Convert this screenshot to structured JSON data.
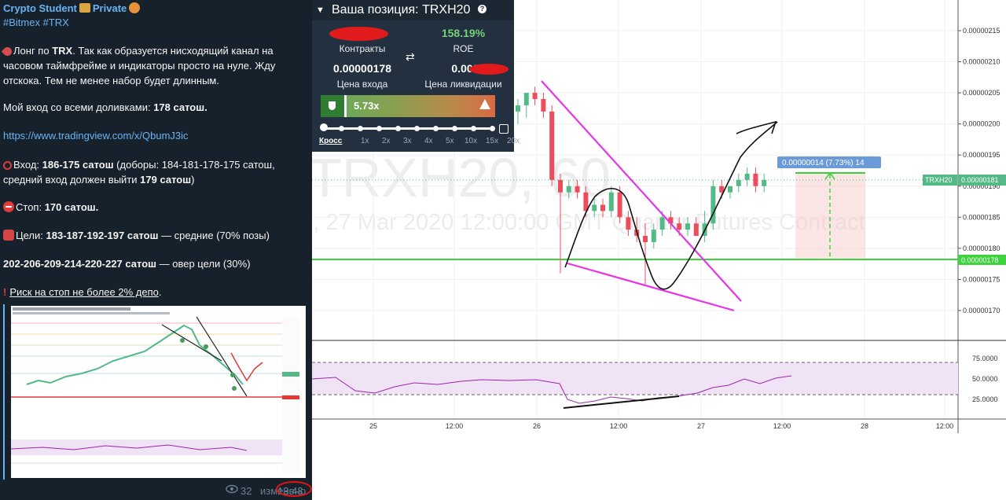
{
  "post": {
    "author": "Crypto Student",
    "author_suffix": "Private",
    "tags": "#Bitmex #TRX",
    "p1_a": "Лонг по ",
    "p1_b": "TRX",
    "p1_c": ". Так как образуется нисходящий канал на часовом таймфрейме и индикаторы просто на нуле. Жду отскока. Тем не менее набор будет длинным.",
    "p2_a": "Мой вход со всеми доливками: ",
    "p2_b": "178 сатош.",
    "link": "https://www.tradingview.com/x/QbumJ3ic",
    "entry_a": "Вход: ",
    "entry_b": "186-175 сатош",
    "entry_c": " (доборы: 184-181-178-175 сатош, средний вход должен выйти ",
    "entry_d": "179 сатош",
    "entry_e": ")",
    "stop_a": "Стоп: ",
    "stop_b": "170 сатош.",
    "targets_a": "Цели: ",
    "targets_b": "183-187-192-197 сатош",
    "targets_c": " — средние (70% позы)",
    "over_a": "202-206-209-214-220-227 сатош",
    "over_b": " — овер цели (30%)",
    "risk": "Риск на стоп не более 2% депо",
    "risk_dot": ".",
    "views": "32",
    "edited": "изменено",
    "time": "13:43"
  },
  "position": {
    "title": "Ваша позиция: TRXH20",
    "contracts_label": "Контракты",
    "roe_value": "158.19%",
    "roe_label": "ROE",
    "entry_value": "0.00000178",
    "entry_label": "Цена входа",
    "liq_value": "0.00000",
    "liq_label": "Цена ликвидации",
    "leverage": "5.73x",
    "leverage_steps": [
      "Кросс",
      "1x",
      "2x",
      "3x",
      "4x",
      "5x",
      "10x",
      "15x",
      "20x"
    ],
    "roe_color": "#76d275"
  },
  "chart": {
    "watermark1": "TRXH20, 60",
    "watermark2": "i, 27 Mar 2020 12:00:00 GMT Quarter Futures Contract",
    "symbol_tag": "TRXH20",
    "last_price": "0.00000181",
    "entry_line_price": "0.00000178",
    "target_label": "0.00000014 (7.73%) 14",
    "price_ticks": [
      "0.00000215",
      "0.00000210",
      "0.00000205",
      "0.00000200",
      "0.00000195",
      "0.00000190",
      "0.00000185",
      "0.00000180",
      "0.00000175",
      "0.00000170"
    ],
    "rsi_ticks": [
      "75.0000",
      "50.0000",
      "25.0000"
    ],
    "time_ticks": [
      "25",
      "12:00",
      "26",
      "12:00",
      "27",
      "12:00",
      "28",
      "12:00"
    ],
    "up_color": "#53b987",
    "down_color": "#eb4d5c"
  },
  "chart_data": {
    "type": "candlestick",
    "title": "TRXH20, 60",
    "ylim": [
      1.65e-06,
      2.16e-06
    ],
    "x": [
      "25",
      "12:00",
      "26",
      "12:00",
      "27",
      "12:00",
      "28",
      "12:00"
    ],
    "rsi_levels": [
      70,
      50,
      30
    ],
    "candles": [
      [
        2.02e-06,
        2.04e-06,
        2e-06,
        2.03e-06
      ],
      [
        2.03e-06,
        2.05e-06,
        2.01e-06,
        2.05e-06
      ],
      [
        2.05e-06,
        2.06e-06,
        2.03e-06,
        2.04e-06
      ],
      [
        2.04e-06,
        2.05e-06,
        2.01e-06,
        2.02e-06
      ],
      [
        2.02e-06,
        2.03e-06,
        1.9e-06,
        1.91e-06
      ],
      [
        1.91e-06,
        1.92e-06,
        1.76e-06,
        1.89e-06
      ],
      [
        1.89e-06,
        1.91e-06,
        1.88e-06,
        1.9e-06
      ],
      [
        1.9e-06,
        1.91e-06,
        1.88e-06,
        1.89e-06
      ],
      [
        1.89e-06,
        1.9e-06,
        1.85e-06,
        1.86e-06
      ],
      [
        1.86e-06,
        1.88e-06,
        1.85e-06,
        1.87e-06
      ],
      [
        1.87e-06,
        1.88e-06,
        1.85e-06,
        1.86e-06
      ],
      [
        1.86e-06,
        1.9e-06,
        1.85e-06,
        1.89e-06
      ],
      [
        1.89e-06,
        1.9e-06,
        1.84e-06,
        1.85e-06
      ],
      [
        1.85e-06,
        1.86e-06,
        1.82e-06,
        1.83e-06
      ],
      [
        1.83e-06,
        1.85e-06,
        1.81e-06,
        1.82e-06
      ],
      [
        1.82e-06,
        1.84e-06,
        1.74e-06,
        1.81e-06
      ],
      [
        1.81e-06,
        1.84e-06,
        1.8e-06,
        1.83e-06
      ],
      [
        1.83e-06,
        1.86e-06,
        1.82e-06,
        1.85e-06
      ],
      [
        1.85e-06,
        1.86e-06,
        1.83e-06,
        1.84e-06
      ],
      [
        1.84e-06,
        1.85e-06,
        1.82e-06,
        1.83e-06
      ],
      [
        1.83e-06,
        1.85e-06,
        1.82e-06,
        1.84e-06
      ],
      [
        1.84e-06,
        1.85e-06,
        1.82e-06,
        1.82e-06
      ],
      [
        1.82e-06,
        1.86e-06,
        1.81e-06,
        1.84e-06
      ],
      [
        1.84e-06,
        1.91e-06,
        1.83e-06,
        1.9e-06
      ],
      [
        1.9e-06,
        1.91e-06,
        1.88e-06,
        1.89e-06
      ],
      [
        1.89e-06,
        1.9e-06,
        1.88e-06,
        1.9e-06
      ],
      [
        1.9e-06,
        1.92e-06,
        1.89e-06,
        1.91e-06
      ],
      [
        1.91e-06,
        1.93e-06,
        1.9e-06,
        1.92e-06
      ],
      [
        1.92e-06,
        1.93e-06,
        1.89e-06,
        1.9e-06
      ],
      [
        1.9e-06,
        1.92e-06,
        1.89e-06,
        1.91e-06
      ]
    ]
  }
}
